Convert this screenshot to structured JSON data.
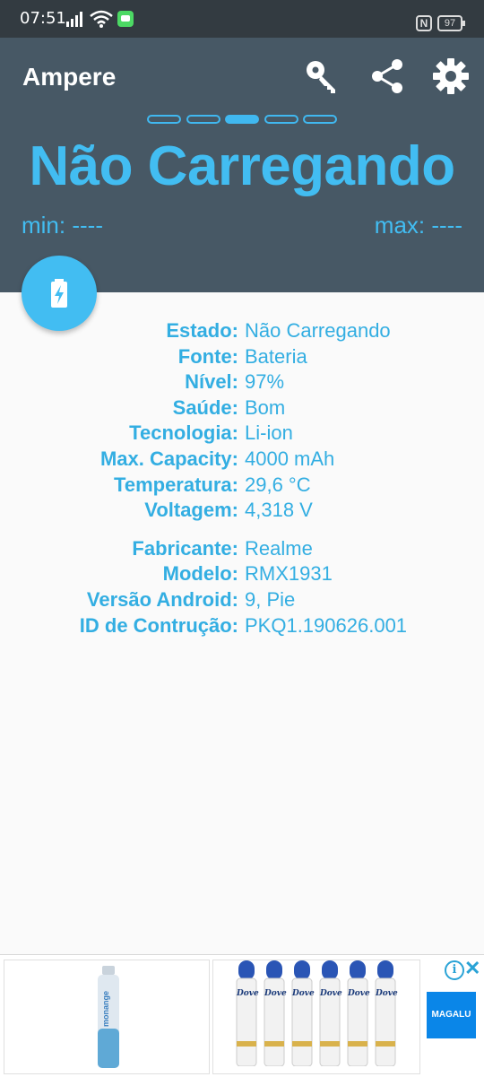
{
  "status_bar": {
    "time": "07:51",
    "battery_level": "97"
  },
  "app": {
    "title": "Ampere"
  },
  "pager": {
    "total": 5,
    "active_index": 2
  },
  "header": {
    "state": "Não Carregando",
    "min": "min: ----",
    "max": "max: ----"
  },
  "battery_info": [
    {
      "label": "Estado:",
      "value": "Não Carregando"
    },
    {
      "label": "Fonte:",
      "value": "Bateria"
    },
    {
      "label": "Nível:",
      "value": "97%"
    },
    {
      "label": "Saúde:",
      "value": "Bom"
    },
    {
      "label": "Tecnologia:",
      "value": "Li-ion"
    },
    {
      "label": "Max. Capacity:",
      "value": "4000 mAh"
    },
    {
      "label": "Temperatura:",
      "value": "29,6 °C"
    },
    {
      "label": "Voltagem:",
      "value": "4,318 V"
    }
  ],
  "device_info": [
    {
      "label": "Fabricante:",
      "value": "Realme"
    },
    {
      "label": "Modelo:",
      "value": "RMX1931"
    },
    {
      "label": "Versão Android:",
      "value": "9, Pie"
    },
    {
      "label": "ID de Contrução:",
      "value": "PKQ1.190626.001"
    }
  ],
  "ad": {
    "brand_left": "monange",
    "brand_right": "Dove",
    "store": "MAGALU"
  },
  "colors": {
    "accent": "#42bdf2",
    "header_bg": "#475865",
    "status_bg": "#333b41"
  },
  "icons": [
    "key-icon",
    "share-icon",
    "settings-gear-icon",
    "battery-charging-icon"
  ]
}
